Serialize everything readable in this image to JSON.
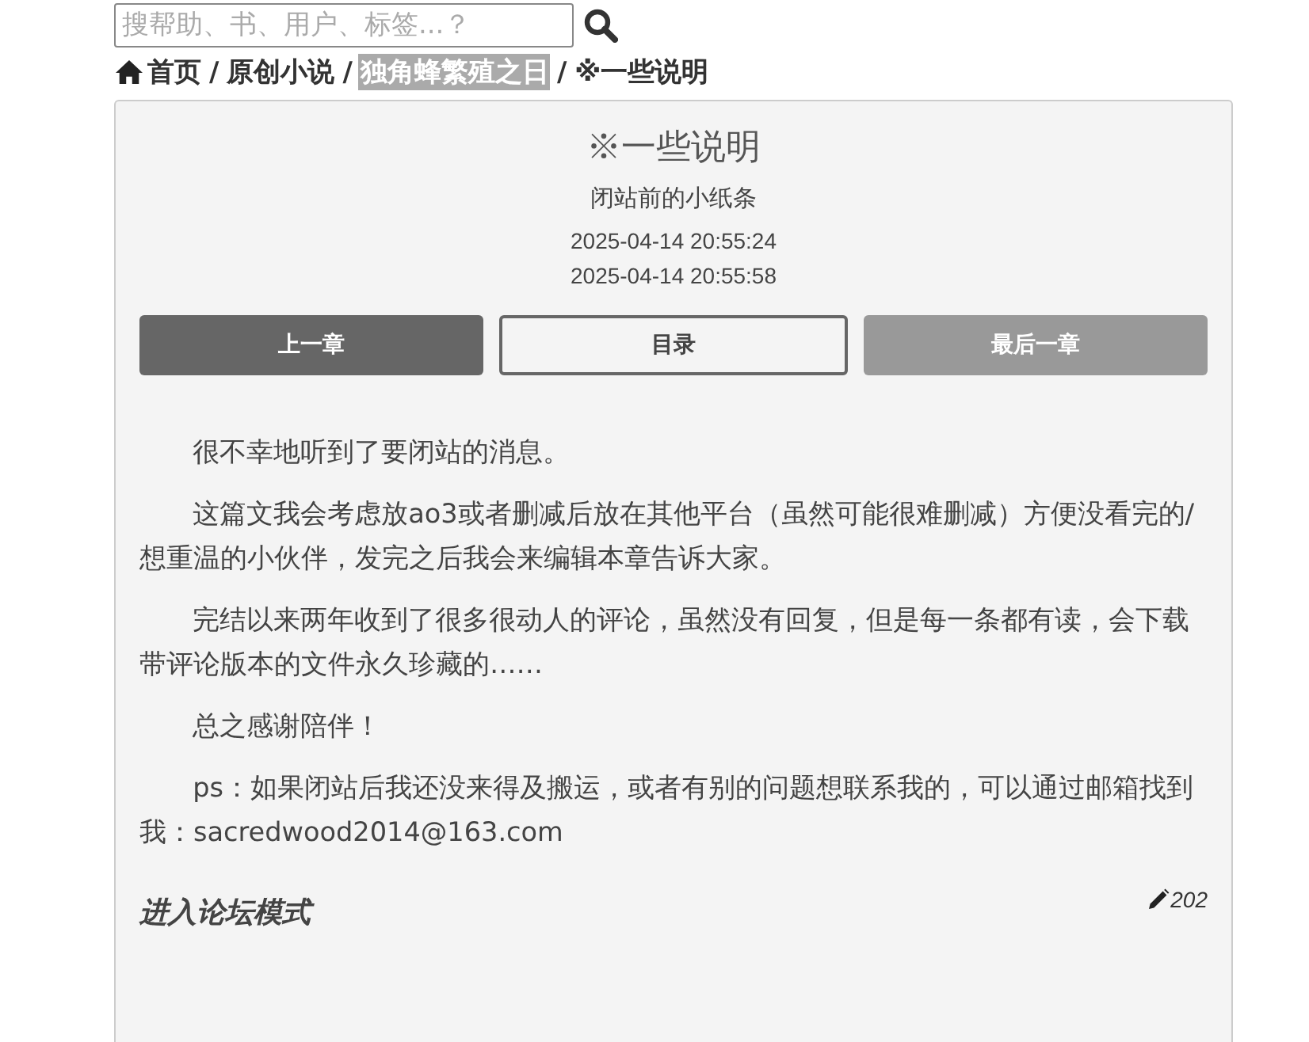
{
  "search": {
    "placeholder": "搜帮助、书、用户、标签...？"
  },
  "breadcrumb_separator": "/",
  "breadcrumb": [
    {
      "label": "首页",
      "kind": "home",
      "highlighted": false
    },
    {
      "label": "原创小说",
      "kind": "link",
      "highlighted": false
    },
    {
      "label": "独角蜂繁殖之日",
      "kind": "link",
      "highlighted": true
    },
    {
      "label": "※一些说明",
      "kind": "link",
      "highlighted": false
    }
  ],
  "chapter": {
    "title": "※一些说明",
    "subtitle": "闭站前的小纸条",
    "dates": [
      "2025-04-14 20:55:24",
      "2025-04-14 20:55:58"
    ]
  },
  "nav_buttons": [
    {
      "label": "上一章",
      "kind": "dark"
    },
    {
      "label": "目录",
      "kind": "outline"
    },
    {
      "label": "最后一章",
      "kind": "muted"
    }
  ],
  "paragraphs": [
    "很不幸地听到了要闭站的消息。",
    "这篇文我会考虑放ao3或者删减后放在其他平台（虽然可能很难删减）方便没看完的/想重温的小伙伴，发完之后我会来编辑本章告诉大家。",
    "完结以来两年收到了很多很动人的评论，虽然没有回复，但是每一条都有读，会下载带评论版本的文件永久珍藏的……",
    "总之感谢陪伴！",
    "ps：如果闭站后我还没来得及搬运，或者有别的问题想联系我的，可以通过邮箱找到我：sacredwood2014@163.com"
  ],
  "forum_link": "进入论坛模式",
  "edit_count": "202"
}
